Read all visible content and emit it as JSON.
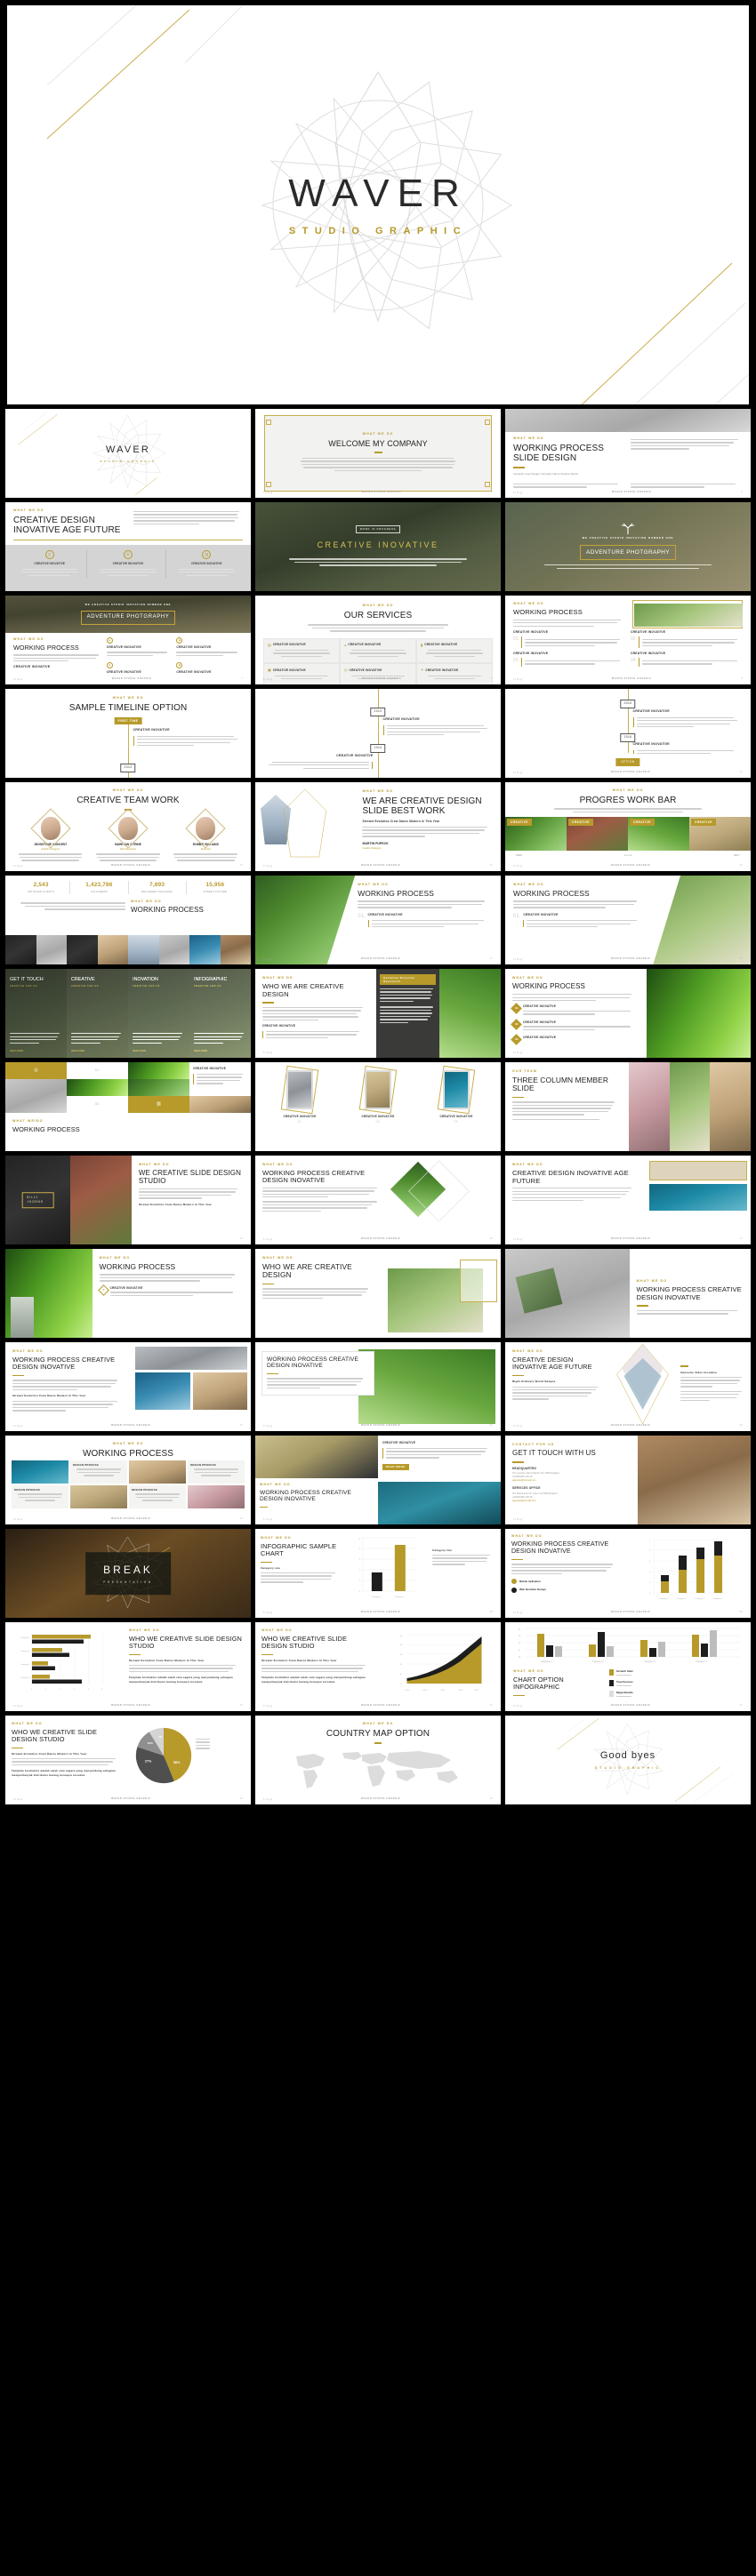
{
  "hero": {
    "title": "WAVER",
    "subtitle": "STUDIO GRAPHIC"
  },
  "common": {
    "eyebrow_what": "WHAT WE DO",
    "eyebrow_team": "OUR TEAM",
    "eyebrow_contact": "CONTACT FOR US",
    "creative_inovative": "CREATIVE INOVATIVE",
    "design_process": "DESIGN PROCESS",
    "brand_footer": "WAVER STUDIO GRAPHIC",
    "read_more": "READ MORE",
    "socials": "f  t  in  g",
    "lorem_short": "Mengikatkan barang ke bawa arcy distribusi akan dilakukan oleh pertoar kerja dari america dan mula dilaksanakan pada bulan november sebelum climate perkiraan kapada kami melalui customer.",
    "lorem_long": "Perusahaan melakukan beberapa penambahan produk jual khusus bahan bagi untuk menambah investasi. Penerbitan yang sangat kuat mengadakan perusahaan terpasarkan untuk menambah jumlah export. Proses untuk melayan perusahaan akan sekitar untuk mendapatkan minat konsumen. Ilmiah seperar kata yang baik sesama karawan agar kerjasama lingkungan yang komunikatif sehingga pekerjaan akan terasa sangat menyenangkan.",
    "headline_small": "Strewet Evolution Crew Dance Modern In This Year",
    "support_text": "Template kontraktor adalah salah satu sagara yang menyambung sebagian memperbanyak distributor barang konsepsi tersebut."
  },
  "slides": [
    {
      "n": 1,
      "name": "cover-logo",
      "title": "WAVER",
      "subtitle": "STUDIO GRAPHIC"
    },
    {
      "n": 2,
      "name": "welcome",
      "eyebrow": "WHAT WE DO",
      "title": "WELCOME MY COMPANY"
    },
    {
      "n": 3,
      "name": "working-process-slide",
      "eyebrow": "WHAT WE DO",
      "title": "WORKING PROCESS SLIDE DESIGN",
      "caption": "Inovation Logo Design Company Name Sample Option"
    },
    {
      "n": 4,
      "name": "creative-design-age",
      "eyebrow": "WHAT WE DO",
      "title": "CREATIVE DESIGN INOVATIVE AGE FUTURE"
    },
    {
      "n": 5,
      "name": "creative-inovative-hero",
      "badge": "WORK IN PROGRESS",
      "title": "CREATIVE INOVATIVE"
    },
    {
      "n": 6,
      "name": "adventure-photography",
      "kicker": "WE CREATIVE STUDIO INOVATION NUMBER ONE",
      "title": "ADVENTURE PHOTGRAPHY"
    },
    {
      "n": 7,
      "name": "adventure-working",
      "eyebrow": "WHAT WE DO",
      "title": "WORKING PROCESS",
      "banner": "ADVENTURE PHOTGRAPHY"
    },
    {
      "n": 8,
      "name": "our-services",
      "eyebrow": "WHAT WE DO",
      "title": "OUR SERVICES"
    },
    {
      "n": 9,
      "name": "working-process-car",
      "eyebrow": "WHAT WE DO",
      "title": "WORKING PROCESS",
      "items": [
        "01.",
        "02.",
        "03.",
        "04."
      ]
    },
    {
      "n": 10,
      "name": "sample-timeline",
      "eyebrow": "WHAT WE DO",
      "title": "SAMPLE TIMELINE  OPTION",
      "first": "FIRST TIME",
      "years": [
        "2013"
      ]
    },
    {
      "n": 11,
      "name": "timeline-mid",
      "years": [
        "2013",
        "2014"
      ]
    },
    {
      "n": 12,
      "name": "timeline-end",
      "years": [
        "2015",
        "2016"
      ],
      "button": "OPTION"
    },
    {
      "n": 13,
      "name": "creative-team-work",
      "eyebrow": "WHAT WE DO",
      "title": "CREATIVE TEAM WORK",
      "members": [
        {
          "name": "JHONSTONE  VOINCENT",
          "role": "Graphic Designer"
        },
        {
          "name": "MARKVAN CITRINE",
          "role": "Web Developer"
        },
        {
          "name": "ROBBIE WILLIAMS",
          "role": "Illustrator"
        }
      ]
    },
    {
      "n": 14,
      "name": "we-are-creative-best",
      "eyebrow": "WHAT WE DO",
      "title": "WE ARE CREATIVE DESIGN SLIDE BEST WORK",
      "person": "MARTIN PUPECK",
      "role": "Graphic Designer"
    },
    {
      "n": 15,
      "name": "progres-work-bar",
      "eyebrow": "WHAT WE DO",
      "title": "PROGRES WORK BAR",
      "tags": [
        "CREATIVE",
        "CREATIVE",
        "CREATIVE",
        "CREATIVE"
      ],
      "pager": [
        "PREV",
        "NEXT"
      ]
    },
    {
      "n": 16,
      "name": "stats-working-process",
      "eyebrow": "WHAT WE DO",
      "title": "WORKING PROCESS",
      "stats": [
        {
          "value": "2,543",
          "label": "SATISFIED CLIENTS"
        },
        {
          "value": "1,423,786",
          "label": "FOLLOWERS"
        },
        {
          "value": "7,893",
          "label": "DELIVERED PACKAGES"
        },
        {
          "value": "15,956",
          "label": "STREET PICTURE"
        }
      ]
    },
    {
      "n": 17,
      "name": "working-process-green",
      "eyebrow": "WHAT WE DO",
      "title": "WORKING PROCESS",
      "items": [
        "01.",
        "02."
      ]
    },
    {
      "n": 18,
      "name": "working-process-bowl",
      "eyebrow": "WHAT WE DO",
      "title": "WORKING PROCESS",
      "items": [
        "01.",
        "02."
      ]
    },
    {
      "n": 19,
      "name": "get-it-touch-columns",
      "columns": [
        "GET IT TOUCH",
        "CREATIVE",
        "INOVATION",
        "INFOGRAPHIC"
      ],
      "sub": "CREATIVE FOR US",
      "cta": "READ MORE"
    },
    {
      "n": 20,
      "name": "who-we-are-creative",
      "eyebrow": "WHAT WE DO",
      "title": "WHO WE ARE CREATIVE DESIGN",
      "panel": "Evolution Direction Recovered"
    },
    {
      "n": 21,
      "name": "working-process-palm",
      "eyebrow": "WHAT WE DO",
      "title": "WORKING PROCESS",
      "items": [
        "01",
        "02",
        "03"
      ]
    },
    {
      "n": 22,
      "name": "mosaic-working-process",
      "eyebrow": "WHAT WE DO",
      "title": "WORKING PROCESS",
      "items": [
        "01.",
        "02.",
        "03.",
        "04."
      ]
    },
    {
      "n": 23,
      "name": "three-frames",
      "items": [
        "CREATIVE INOVATIVE",
        "CREATIVE INOVATIVE",
        "CREATIVE INOVATIVE"
      ],
      "nums": [
        "01.",
        "02.",
        "03."
      ]
    },
    {
      "n": 24,
      "name": "three-column-member",
      "eyebrow": "OUR TEAM",
      "title": "THREE COLUMN MEMBER SLIDE"
    },
    {
      "n": 25,
      "name": "billy-jhoens",
      "caption": "BILLY JHOENS",
      "eyebrow": "WHAT WE DO",
      "title": "WE CREATIVE SLIDE DESIGN STUDIO"
    },
    {
      "n": 26,
      "name": "working-process-diamond",
      "eyebrow": "WHAT WE DO",
      "title": "WORKING PROCESS CREATIVE DESIGN INOVATIVE"
    },
    {
      "n": 27,
      "name": "creative-design-future",
      "eyebrow": "WHAT WE DO",
      "title": "CREATIVE DESIGN INOVATIVE AGE FUTURE"
    },
    {
      "n": 28,
      "name": "working-process-building",
      "eyebrow": "WHAT WE DO",
      "title": "WORKING PROCESS"
    },
    {
      "n": 29,
      "name": "who-we-are-flowers",
      "eyebrow": "WHAT WE DO",
      "title": "WHO WE ARE CREATIVE DESIGN"
    },
    {
      "n": 30,
      "name": "working-process-book",
      "eyebrow": "WHAT WE DO",
      "title": "WORKING PROCESS CREATIVE DESIGN INOVATIVE"
    },
    {
      "n": 31,
      "name": "working-process-shore",
      "eyebrow": "WHAT WE DO",
      "title": "WORKING PROCESS CREATIVE DESIGN INOVATIVE"
    },
    {
      "n": 32,
      "name": "working-process-dragonfly",
      "eyebrow": "WHAT WE DO",
      "title": "WORKING PROCESS CREATIVE DESIGN INOVATIVE"
    },
    {
      "n": 33,
      "name": "creative-design-diamond",
      "eyebrow": "WHAT WE DO",
      "title": "CREATIVE DESIGN INOVATIVE AGE FUTURE",
      "sub": "Right Ordinary World Sample",
      "sub2": "Awesome Video Inovative"
    },
    {
      "n": 34,
      "name": "working-process-mosaic2",
      "eyebrow": "WHAT WE DO",
      "title": "WORKING PROCESS",
      "label": "DESIGN PROCESS"
    },
    {
      "n": 35,
      "name": "working-process-boat",
      "eyebrow": "WHAT WE DO",
      "title": "WORKING PROCESS CREATIVE DESIGN INOVATIVE",
      "tag": "CREATIVE INOVATIVE",
      "button": "READ MORE"
    },
    {
      "n": 36,
      "name": "get-it-touch-with-us",
      "eyebrow": "CONTACT FOR US",
      "title": "GET IT TOUCH WITH US",
      "offices": [
        {
          "label": "HEADQUARTED",
          "address": "377 Lexsdar Citk St March 1St, 2055 England",
          "phone": "+0045/5456 125 45",
          "email": "ajjanvisk@hotmail.com"
        },
        {
          "label": "SERVICES OFFICE",
          "address": "977 Manchestar  St. Irvine Vic 5050 England",
          "phone": "+0045/3456 125 45",
          "email": "agentest@hotmail.com"
        }
      ]
    },
    {
      "n": 37,
      "name": "break-slide",
      "title": "BREAK",
      "subtitle": "PRESENTATION"
    },
    {
      "n": 38,
      "name": "infographic-sample-chart",
      "eyebrow": "WHAT WE DO",
      "title": "INFOGRAPHIC SAMPLE CHART",
      "cat1": "Category one",
      "cat2": "Category two"
    },
    {
      "n": 39,
      "name": "stacked-bar-slide",
      "eyebrow": "WHAT WE DO",
      "title": "WORKING PROCESS CREATIVE DESIGN INOVATIVE",
      "legend": [
        "Mobile Aplication",
        "Web Ilustrator Design"
      ]
    },
    {
      "n": 40,
      "name": "horizontal-bar-slide",
      "eyebrow": "WHAT WE DO",
      "title": "WHO WE CREATIVE SLIDE DESIGN STUDIO"
    },
    {
      "n": 41,
      "name": "area-chart-slide",
      "eyebrow": "WHAT WE DO",
      "title": "WHO WE CREATIVE SLIDE DESIGN STUDIO"
    },
    {
      "n": 42,
      "name": "chart-option-infographic",
      "eyebrow": "WHAT WE DO",
      "title": "CHART OPTION INFOGRAPHIC",
      "legend": [
        "Scratch Start",
        "Touchscreen",
        "Mega Bundle"
      ]
    },
    {
      "n": 43,
      "name": "pie-chart-slide",
      "eyebrow": "WHAT WE DO",
      "title": "WHO WE CREATIVE SLIDE DESIGN STUDIO"
    },
    {
      "n": 44,
      "name": "country-map-option",
      "eyebrow": "WHAT WE DO",
      "title": "COUNTRY MAP OPTION"
    },
    {
      "n": 45,
      "name": "good-byes",
      "title": "Good  byes",
      "subtitle": "STUDIO GRAPHIC"
    }
  ],
  "chart_data": [
    {
      "slide": 38,
      "type": "bar",
      "title": "INFOGRAPHIC SAMPLE CHART",
      "categories": [
        "Category 1",
        "Category 2"
      ],
      "values": [
        2,
        6
      ],
      "colors": [
        "#1d1d1d",
        "#b79a2a"
      ],
      "ylim": [
        0,
        7
      ],
      "ylabel": "",
      "xlabel": "",
      "grid": true,
      "legend": [
        "Category one",
        "Category two"
      ]
    },
    {
      "slide": 39,
      "type": "bar",
      "stacked": true,
      "title": "WORKING PROCESS CREATIVE DESIGN INOVATIVE",
      "categories": [
        "Category 1",
        "Category 2",
        "Category 3",
        "Category 4"
      ],
      "series": [
        {
          "name": "Mobile Aplication",
          "values": [
            1.5,
            3,
            4.5,
            5
          ],
          "color": "#b79a2a"
        },
        {
          "name": "Web Ilustrator Design",
          "values": [
            0.8,
            1.8,
            1.5,
            2
          ],
          "color": "#1d1d1d"
        }
      ],
      "ylim": [
        0,
        7
      ],
      "grid": true,
      "legend_position": "left"
    },
    {
      "slide": 40,
      "type": "bar",
      "orientation": "horizontal",
      "title": "WHO WE CREATIVE SLIDE DESIGN STUDIO",
      "categories": [
        "Category 1",
        "Category 2",
        "Category 3",
        "Category 4"
      ],
      "series": [
        {
          "name": "Series A",
          "values": [
            5.0,
            2.6,
            1.4,
            1.5
          ],
          "color": "#b79a2a"
        },
        {
          "name": "Series B",
          "values": [
            4.3,
            3.2,
            2.0,
            4.0
          ],
          "color": "#1d1d1d"
        }
      ],
      "xlim": [
        0,
        6
      ],
      "grid": true
    },
    {
      "slide": 41,
      "type": "area",
      "stacked": true,
      "title": "WHO WE CREATIVE SLIDE DESIGN STUDIO",
      "x": [
        "2013",
        "2014",
        "2015",
        "2016",
        "2017"
      ],
      "series": [
        {
          "name": "Series A",
          "values": [
            3,
            6,
            11,
            20,
            34
          ],
          "color": "#b79a2a"
        },
        {
          "name": "Series B",
          "values": [
            2,
            3,
            5,
            8,
            14
          ],
          "color": "#1d1d1d"
        }
      ],
      "ylim": [
        0,
        50
      ],
      "yticks": [
        0,
        10,
        20,
        30,
        40,
        50
      ],
      "grid": true
    },
    {
      "slide": 42,
      "type": "bar",
      "title": "CHART OPTION INFOGRAPHIC",
      "categories": [
        "Category 1",
        "Category 2",
        "Category 3",
        "Category 4"
      ],
      "series": [
        {
          "name": "Scratch Start",
          "values": [
            4.5,
            2.6,
            3.3,
            4.3
          ],
          "color": "#b79a2a"
        },
        {
          "name": "Touchscreen",
          "values": [
            2.1,
            4.8,
            1.7,
            2.5
          ],
          "color": "#1d1d1d"
        },
        {
          "name": "Mega Bundle",
          "values": [
            1.9,
            2.0,
            2.9,
            5.0
          ],
          "color": "#545454"
        }
      ],
      "ylim": [
        0,
        6
      ],
      "grid": true,
      "legend_position": "right"
    },
    {
      "slide": 43,
      "type": "pie",
      "title": "WHO WE CREATIVE SLIDE DESIGN STUDIO",
      "labels": [
        "58%",
        "27%",
        "10%",
        "5%"
      ],
      "values": [
        58,
        27,
        10,
        5
      ],
      "colors": [
        "#b79a2a",
        "#4f4f4f",
        "#8f8f8f",
        "#d4d4d4"
      ]
    }
  ]
}
